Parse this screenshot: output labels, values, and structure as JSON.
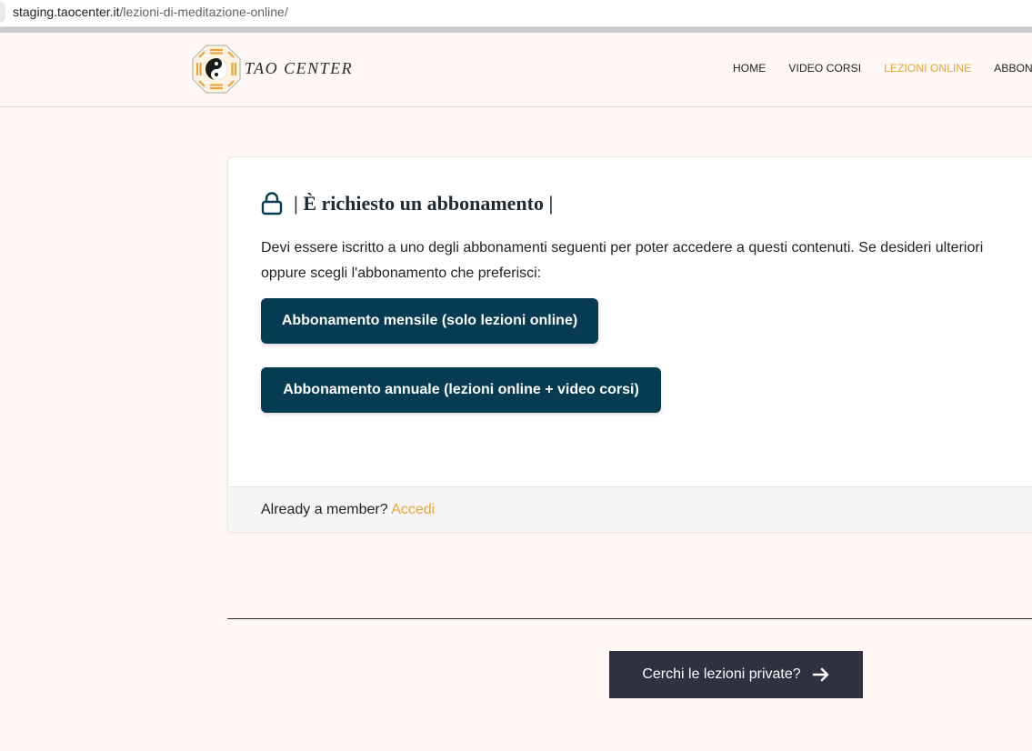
{
  "browser": {
    "url_host": "staging.taocenter.it",
    "url_path": "/lezioni-di-meditazione-online/"
  },
  "header": {
    "logo_text": "TAO CENTER",
    "nav": [
      {
        "label": "HOME",
        "active": false
      },
      {
        "label": "VIDEO CORSI",
        "active": false
      },
      {
        "label": "LEZIONI ONLINE",
        "active": true
      },
      {
        "label": "ABBONA",
        "active": false
      }
    ]
  },
  "card": {
    "icon": "lock-icon",
    "title": "| È richiesto un abbonamento |",
    "desc_line1": "Devi essere iscritto a uno degli abbonamenti seguenti per poter accedere a questi contenuti. Se desideri ulteriori",
    "desc_line2": "oppure scegli l'abbonamento che preferisci:",
    "btn_monthly": "Abbonamento mensile (solo lezioni online)",
    "btn_annual": "Abbonamento annuale (lezioni online + video corsi)",
    "footer_text": "Already a member?",
    "footer_link": "Accedi"
  },
  "private": {
    "label": "Cerchi le lezioni private?",
    "icon": "arrow-right-icon"
  },
  "colors": {
    "accent": "#e8a33d",
    "button": "#053c53",
    "dark_button": "#2f3140",
    "page_bg": "#fff7f4"
  }
}
